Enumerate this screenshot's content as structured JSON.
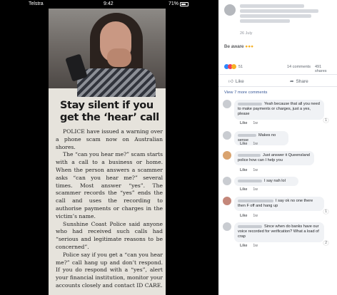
{
  "status_bar": {
    "carrier": "Telstra",
    "time": "9:42",
    "battery": "71%"
  },
  "article": {
    "headline": "Stay silent if you get the ‘hear’ call",
    "paragraphs": [
      "POLICE have issued a warning over a phone scam now on Australian shores.",
      "The “can you hear me?” scam starts with a call to a business or home. When the person answers a scammer asks “can you hear me?” several times. Most answer “yes”. The scammer records the “yes” ends the call and uses the recording to authorise payments or charges in the victim’s name.",
      "Sunshine Coast Police said anyone who had received such calls had “serious and legitimate reasons to be concerned”.",
      "Police say if you get a “can you hear me?” call hang up and don’t respond. If you do respond with a “yes”, alert your financial institution, monitor your accounts closely and contact ID CARE."
    ]
  },
  "post": {
    "date": "26 July",
    "text": "Be aware",
    "reaction_count": "51",
    "comment_count": "14 comments",
    "share_count": "491 shares",
    "like_label": "Like",
    "share_label": "Share",
    "more_comments": "View 7 more comments"
  },
  "comments": [
    {
      "text": "Yeah because that all you need to make payments or charges, just a yes, please",
      "like": "Like",
      "time": "1w",
      "badge": "1"
    },
    {
      "text": "Makes no sense",
      "like": "Like",
      "time": "1w",
      "badge": ""
    },
    {
      "text": "Just answer it Queensland police how can I help you",
      "like": "Like",
      "time": "1w",
      "badge": ""
    },
    {
      "text": "I say nah lol",
      "like": "Like",
      "time": "1w",
      "badge": ""
    },
    {
      "text": "I say ok no one there then F off and hang up",
      "like": "Like",
      "time": "1w",
      "badge": "1"
    },
    {
      "text": "Since when do banks have our voice recorded for verification? What a load of crap",
      "like": "Like",
      "time": "1w",
      "badge": "2"
    }
  ],
  "colors": {
    "link": "#385898",
    "like_blue": "#2d88ff",
    "love_red": "#f33e58",
    "bubble": "#f0f2f5"
  }
}
